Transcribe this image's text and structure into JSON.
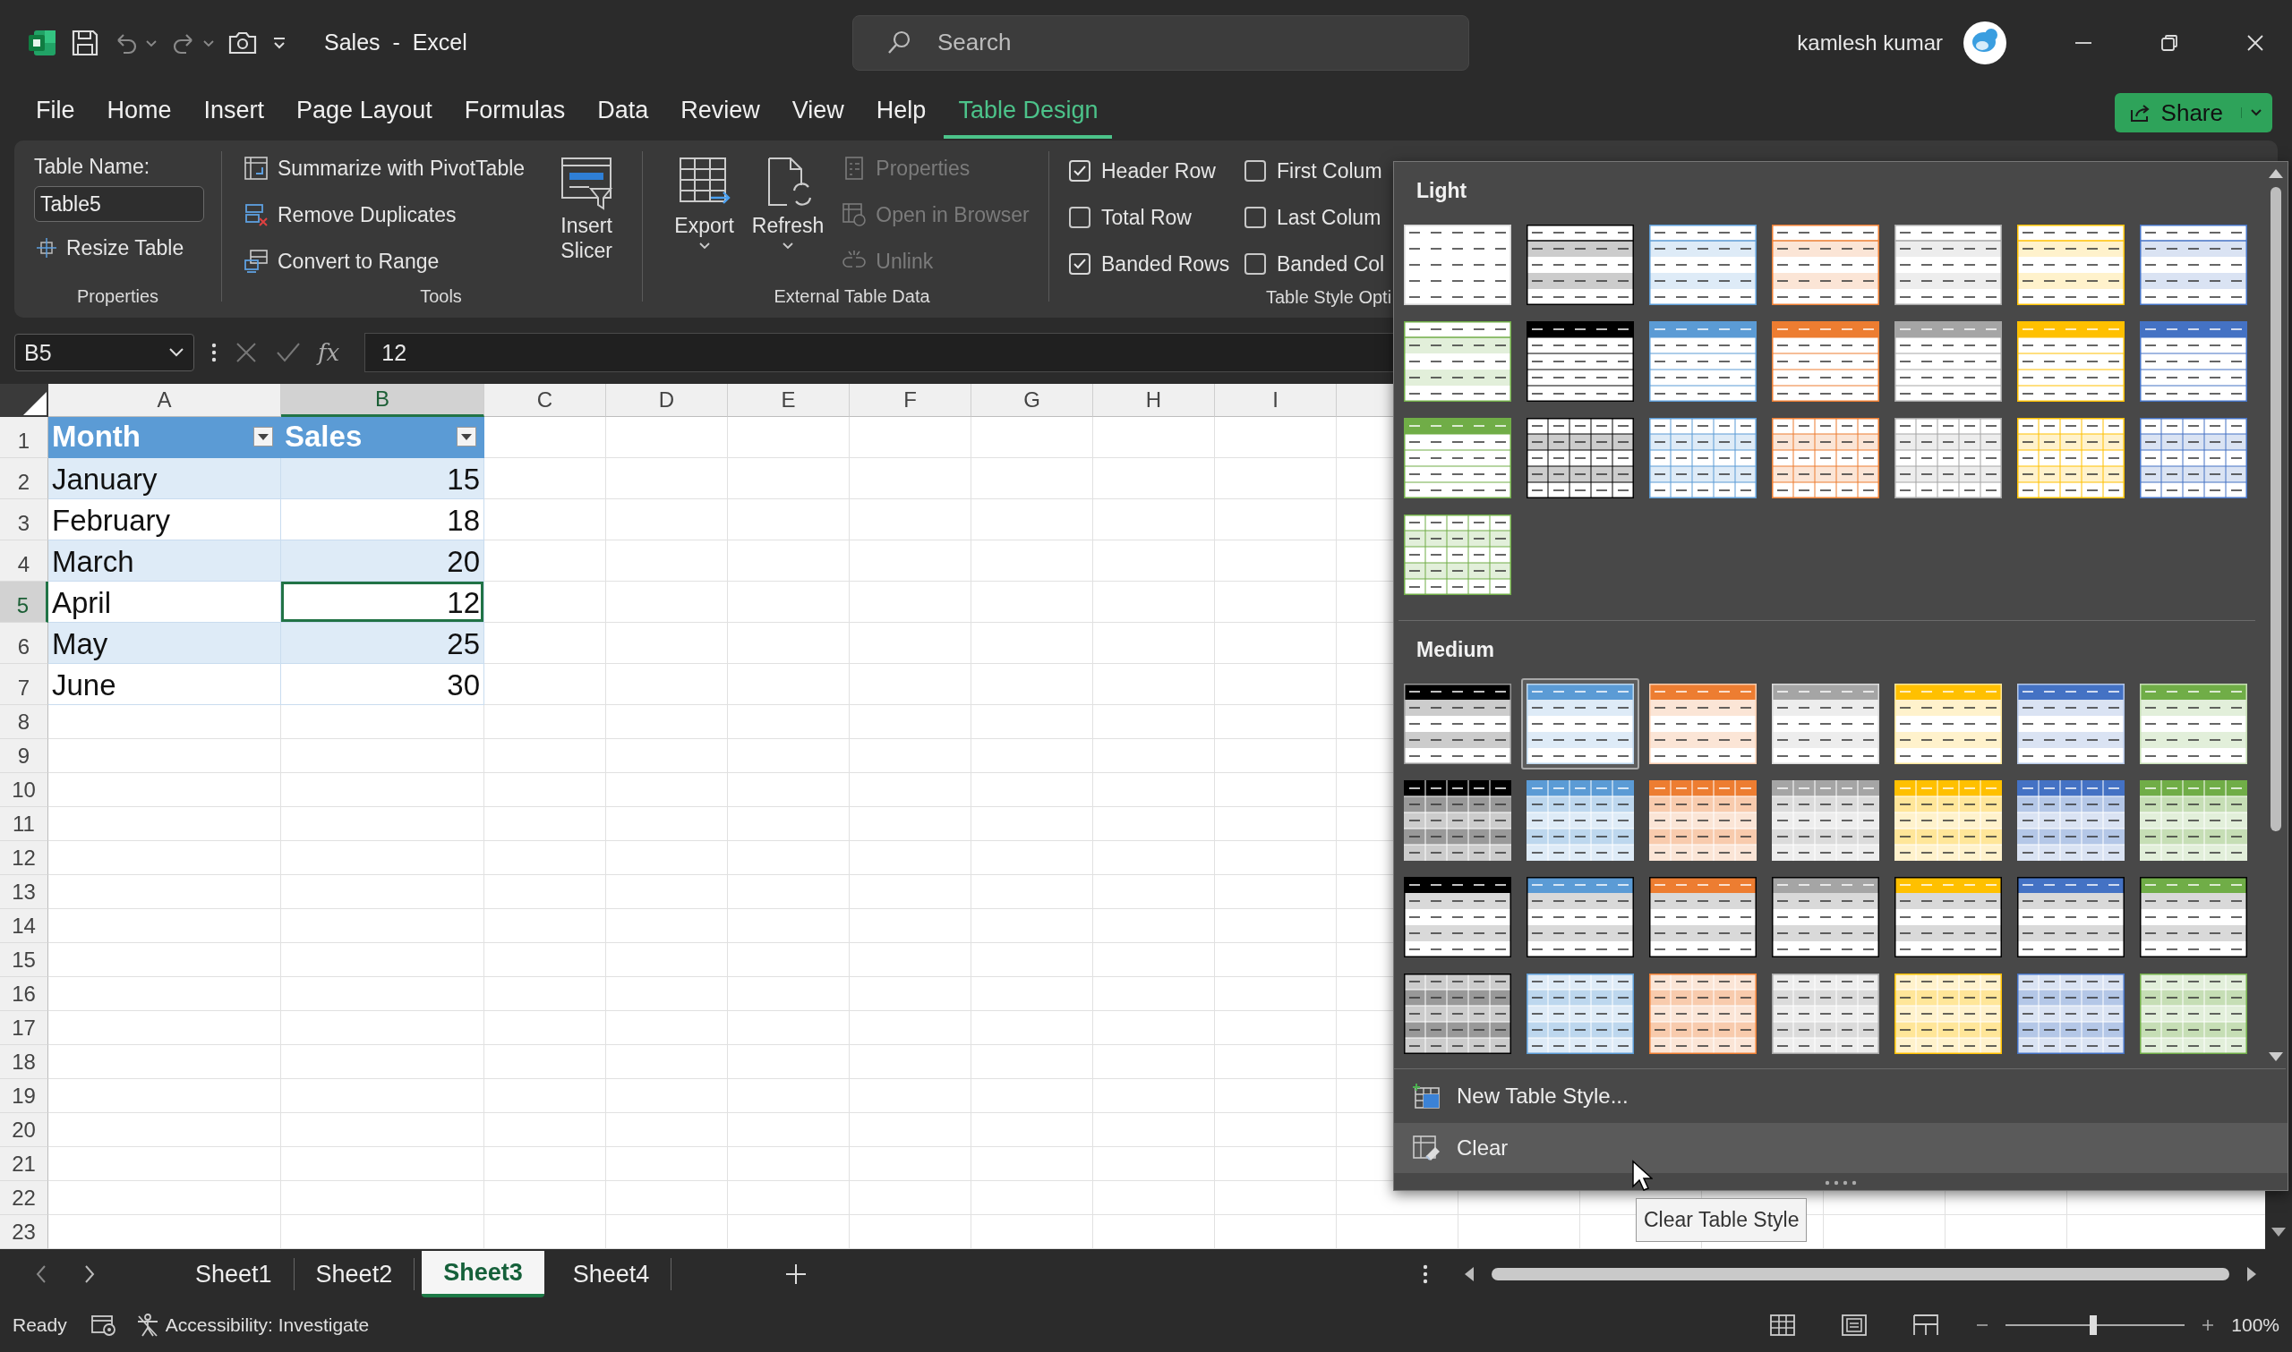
{
  "title_bar": {
    "document_title": "Sales  -  Excel",
    "search": {
      "placeholder": "Search"
    },
    "user_name": "kamlesh kumar"
  },
  "menu_tabs": [
    {
      "label": "File",
      "selected": false
    },
    {
      "label": "Home",
      "selected": false
    },
    {
      "label": "Insert",
      "selected": false
    },
    {
      "label": "Page Layout",
      "selected": false
    },
    {
      "label": "Formulas",
      "selected": false
    },
    {
      "label": "Data",
      "selected": false
    },
    {
      "label": "Review",
      "selected": false
    },
    {
      "label": "View",
      "selected": false
    },
    {
      "label": "Help",
      "selected": false
    },
    {
      "label": "Table Design",
      "selected": true
    }
  ],
  "share_button": "Share",
  "ribbon": {
    "properties": {
      "table_name_label": "Table Name:",
      "table_name_value": "Table5",
      "resize_button": "Resize Table",
      "group_label": "Properties"
    },
    "tools": {
      "buttons": [
        "Summarize with PivotTable",
        "Remove Duplicates",
        "Convert to Range"
      ],
      "slicer_button": "Insert Slicer",
      "group_label": "Tools"
    },
    "external": {
      "large_buttons": [
        "Export",
        "Refresh"
      ],
      "small_buttons": [
        {
          "label": "Properties",
          "disabled": true
        },
        {
          "label": "Open in Browser",
          "disabled": true
        },
        {
          "label": "Unlink",
          "disabled": true
        }
      ],
      "group_label": "External Table Data"
    },
    "style_options": {
      "options": [
        {
          "label": "Header Row",
          "checked": true
        },
        {
          "label": "Total Row",
          "checked": false
        },
        {
          "label": "Banded Rows",
          "checked": true
        },
        {
          "label": "First Colum",
          "checked": false
        },
        {
          "label": "Last Colum",
          "checked": false
        },
        {
          "label": "Banded Col",
          "checked": false
        }
      ],
      "group_label": "Table Style Opti"
    }
  },
  "formula_bar": {
    "name_box": "B5",
    "function_label": "fx",
    "value": "12"
  },
  "sheet": {
    "columns": [
      {
        "label": "A",
        "selected": false
      },
      {
        "label": "B",
        "selected": true
      },
      {
        "label": "C",
        "selected": false
      },
      {
        "label": "D",
        "selected": false
      },
      {
        "label": "E",
        "selected": false
      },
      {
        "label": "F",
        "selected": false
      },
      {
        "label": "G",
        "selected": false
      },
      {
        "label": "H",
        "selected": false
      },
      {
        "label": "I",
        "selected": false
      }
    ],
    "rows": [
      {
        "label": "1",
        "selected": false
      },
      {
        "label": "2",
        "selected": false
      },
      {
        "label": "3",
        "selected": false
      },
      {
        "label": "4",
        "selected": false
      },
      {
        "label": "5",
        "selected": true
      },
      {
        "label": "6",
        "selected": false
      },
      {
        "label": "7",
        "selected": false
      },
      {
        "label": "8",
        "selected": false
      },
      {
        "label": "9",
        "selected": false
      },
      {
        "label": "10",
        "selected": false
      },
      {
        "label": "11",
        "selected": false
      },
      {
        "label": "12",
        "selected": false
      },
      {
        "label": "13",
        "selected": false
      },
      {
        "label": "14",
        "selected": false
      },
      {
        "label": "15",
        "selected": false
      },
      {
        "label": "16",
        "selected": false
      },
      {
        "label": "17",
        "selected": false
      },
      {
        "label": "18",
        "selected": false
      },
      {
        "label": "19",
        "selected": false
      },
      {
        "label": "20",
        "selected": false
      },
      {
        "label": "21",
        "selected": false
      },
      {
        "label": "22",
        "selected": false
      },
      {
        "label": "23",
        "selected": false
      }
    ],
    "table": {
      "header": [
        "Month",
        "Sales"
      ],
      "rows": [
        {
          "cells": [
            {
              "text": "January",
              "selected": false
            },
            {
              "text": "15",
              "selected": false
            }
          ]
        },
        {
          "cells": [
            {
              "text": "February",
              "selected": false
            },
            {
              "text": "18",
              "selected": false
            }
          ]
        },
        {
          "cells": [
            {
              "text": "March",
              "selected": false
            },
            {
              "text": "20",
              "selected": false
            }
          ]
        },
        {
          "cells": [
            {
              "text": "April",
              "selected": false
            },
            {
              "text": "12",
              "selected": true
            }
          ]
        },
        {
          "cells": [
            {
              "text": "May",
              "selected": false
            },
            {
              "text": "25",
              "selected": false
            }
          ]
        },
        {
          "cells": [
            {
              "text": "June",
              "selected": false
            },
            {
              "text": "30",
              "selected": false
            }
          ]
        }
      ]
    }
  },
  "sheet_tabs": [
    {
      "label": "Sheet1",
      "selected": false
    },
    {
      "label": "Sheet2",
      "selected": false
    },
    {
      "label": "Sheet3",
      "selected": true
    },
    {
      "label": "Sheet4",
      "selected": false
    }
  ],
  "status_bar": {
    "ready": "Ready",
    "accessibility": "Accessibility: Investigate",
    "zoom": {
      "level": 0.49
    },
    "zoom_reading": "100%"
  },
  "gallery": {
    "sections": [
      {
        "label": "Light",
        "styles": [
          {
            "kind": "none",
            "selected": false
          },
          {
            "kind": "light-banded",
            "color": "#000000",
            "selected": false
          },
          {
            "kind": "light-banded",
            "color": "#5b9bd5",
            "selected": false
          },
          {
            "kind": "light-banded",
            "color": "#ed7d31",
            "selected": false
          },
          {
            "kind": "light-banded",
            "color": "#a5a5a5",
            "selected": false
          },
          {
            "kind": "light-banded",
            "color": "#ffc000",
            "selected": false
          },
          {
            "kind": "light-banded",
            "color": "#4472c4",
            "selected": false
          },
          {
            "kind": "light-banded",
            "color": "#70ad47",
            "selected": false
          },
          {
            "kind": "light-header",
            "color": "#000000",
            "selected": false
          },
          {
            "kind": "light-header",
            "color": "#5b9bd5",
            "selected": false
          },
          {
            "kind": "light-header",
            "color": "#ed7d31",
            "selected": false
          },
          {
            "kind": "light-header",
            "color": "#a5a5a5",
            "selected": false
          },
          {
            "kind": "light-header",
            "color": "#ffc000",
            "selected": false
          },
          {
            "kind": "light-header",
            "color": "#4472c4",
            "selected": false
          },
          {
            "kind": "light-header",
            "color": "#70ad47",
            "selected": false
          },
          {
            "kind": "light-grid",
            "color": "#000000",
            "selected": false
          },
          {
            "kind": "light-grid",
            "color": "#5b9bd5",
            "selected": false
          },
          {
            "kind": "light-grid",
            "color": "#ed7d31",
            "selected": false
          },
          {
            "kind": "light-grid",
            "color": "#a5a5a5",
            "selected": false
          },
          {
            "kind": "light-grid",
            "color": "#ffc000",
            "selected": false
          },
          {
            "kind": "light-grid",
            "color": "#4472c4",
            "selected": false
          },
          {
            "kind": "light-grid",
            "color": "#70ad47",
            "selected": false
          }
        ]
      },
      {
        "label": "Medium",
        "styles": [
          {
            "kind": "medium-banded",
            "color": "#000000",
            "selected": false
          },
          {
            "kind": "medium-banded",
            "color": "#5b9bd5",
            "selected": true
          },
          {
            "kind": "medium-banded",
            "color": "#ed7d31",
            "selected": false
          },
          {
            "kind": "medium-banded",
            "color": "#a5a5a5",
            "selected": false
          },
          {
            "kind": "medium-banded",
            "color": "#ffc000",
            "selected": false
          },
          {
            "kind": "medium-banded",
            "color": "#4472c4",
            "selected": false
          },
          {
            "kind": "medium-banded",
            "color": "#70ad47",
            "selected": false
          },
          {
            "kind": "medium-grid",
            "color": "#000000",
            "selected": false
          },
          {
            "kind": "medium-grid",
            "color": "#5b9bd5",
            "selected": false
          },
          {
            "kind": "medium-grid",
            "color": "#ed7d31",
            "selected": false
          },
          {
            "kind": "medium-grid",
            "color": "#a5a5a5",
            "selected": false
          },
          {
            "kind": "medium-grid",
            "color": "#ffc000",
            "selected": false
          },
          {
            "kind": "medium-grid",
            "color": "#4472c4",
            "selected": false
          },
          {
            "kind": "medium-grid",
            "color": "#70ad47",
            "selected": false
          },
          {
            "kind": "medium-gray",
            "color": "#000000",
            "selected": false
          },
          {
            "kind": "medium-gray",
            "color": "#5b9bd5",
            "selected": false
          },
          {
            "kind": "medium-gray",
            "color": "#ed7d31",
            "selected": false
          },
          {
            "kind": "medium-gray",
            "color": "#a5a5a5",
            "selected": false
          },
          {
            "kind": "medium-gray",
            "color": "#ffc000",
            "selected": false
          },
          {
            "kind": "medium-gray",
            "color": "#4472c4",
            "selected": false
          },
          {
            "kind": "medium-gray",
            "color": "#70ad47",
            "selected": false
          },
          {
            "kind": "medium-tint-grid",
            "color": "#000000",
            "selected": false
          },
          {
            "kind": "medium-tint-grid",
            "color": "#5b9bd5",
            "selected": false
          },
          {
            "kind": "medium-tint-grid",
            "color": "#ed7d31",
            "selected": false
          },
          {
            "kind": "medium-tint-grid",
            "color": "#a5a5a5",
            "selected": false
          },
          {
            "kind": "medium-tint-grid",
            "color": "#ffc000",
            "selected": false
          },
          {
            "kind": "medium-tint-grid",
            "color": "#4472c4",
            "selected": false
          },
          {
            "kind": "medium-tint-grid",
            "color": "#70ad47",
            "selected": false
          }
        ]
      }
    ],
    "commands": [
      {
        "label": "New Table Style...",
        "hovered": false
      },
      {
        "label": "Clear",
        "hovered": true
      }
    ],
    "tooltip": "Clear Table Style"
  }
}
